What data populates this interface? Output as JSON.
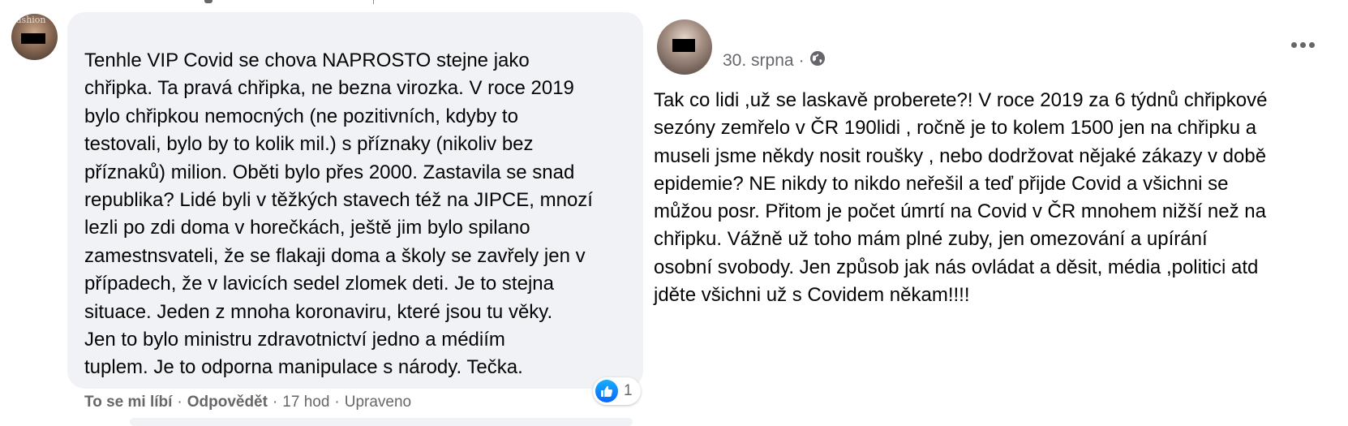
{
  "comment": {
    "lines": [
      "Tenhle VIP Covid se chova NAPROSTO stejne jako",
      "chřipka. Ta pravá chřipka, ne bezna virozka. V roce 2019",
      "bylo chřipkou nemocných (ne pozitivních, kdyby to",
      "testovali, bylo by to kolik mil.) s příznaky (nikoliv bez",
      "příznaků) milion. Oběti bylo přes 2000. Zastavila se snad",
      "republika? Lidé byli v těžkých stavech též na JIPCE, mnozí",
      "lezli po zdi doma v horečkách, ještě jim bylo spilano",
      "zamestnsvateli, že se flakaji doma a školy se zavřely jen v",
      "případech, že v lavicích sedel zlomek deti. Je to stejna",
      "situace. Jeden z mnoha koronaviru, které jsou tu věky.",
      "Jen to bylo ministru zdravotnictví jedno a médiím",
      "tuplem. Je to odporna manipulace s národy. Tečka."
    ],
    "avatar_tag": "ashion",
    "reaction_count": "1",
    "like_label": "To se mi líbí",
    "reply_label": "Odpovědět",
    "separator": "·",
    "time": "17 hod",
    "edited": "Upraveno"
  },
  "post": {
    "date": "30. srpna",
    "separator": "·",
    "audience_icon": "globe-icon",
    "more_icon": "more-options-icon",
    "lines": [
      "Tak co lidi ,už se laskavě proberete?! V roce 2019 za 6 týdnů chřipkové",
      "sezóny zemřelo v ČR 190lidi , ročně je to kolem 1500 jen na chřipku a",
      "museli jsme někdy nosit roušky , nebo dodržovat nějaké zákazy v době",
      "epidemie? NE nikdy to nikdo neřešil a teď přijde Covid a všichni se",
      "můžou posr. Přitom je počet úmrtí na Covid v ČR mnohem nižší než na",
      "chřipku. Vážně už toho mám plné zuby, jen omezování a upírání",
      "osobní svobody. Jen způsob jak nás ovládat a děsit, média ,politici atd",
      "jděte všichni už s Covidem někam!!!!"
    ]
  },
  "colors": {
    "bubble": "#f0f2f5",
    "secondary_text": "#65676b",
    "like_blue": "#0866ff"
  }
}
